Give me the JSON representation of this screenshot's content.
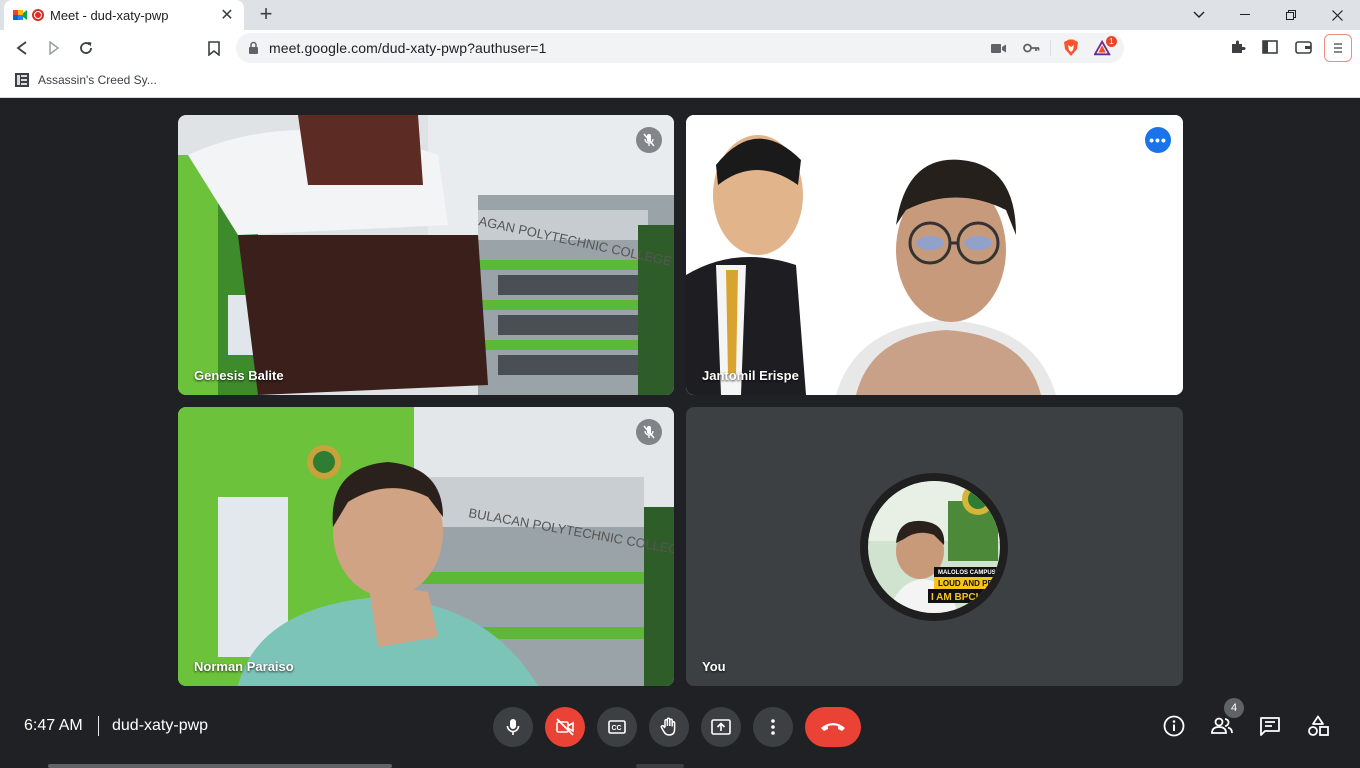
{
  "browser": {
    "tab_title": "Meet - dud-xaty-pwp",
    "url": "meet.google.com/dud-xaty-pwp?authuser=1",
    "bookmark": "Assassin's Creed Sy...",
    "brave_badge_count": "1"
  },
  "meet": {
    "participants": [
      {
        "name": "Genesis Balite",
        "muted": true
      },
      {
        "name": "Jantomil Erispe",
        "muted": false,
        "active": true
      },
      {
        "name": "Norman Paraiso",
        "muted": true
      },
      {
        "name": "You",
        "muted": false
      }
    ],
    "background_sign_1": "AGAN POLYTECHNIC COLLEGE",
    "background_sign_2": "BULACAN POLYTECHNIC COLLEGE",
    "avatar_text_1": "MALOLOS CAMPUS",
    "avatar_text_2": "LOUD AND PROUD",
    "avatar_text_3": "I AM BPCIAN",
    "accent_color": "#8ab4f8",
    "danger_color": "#ea4335"
  },
  "bottombar": {
    "time": "6:47 AM",
    "meeting_code": "dud-xaty-pwp",
    "people_count": "4"
  }
}
